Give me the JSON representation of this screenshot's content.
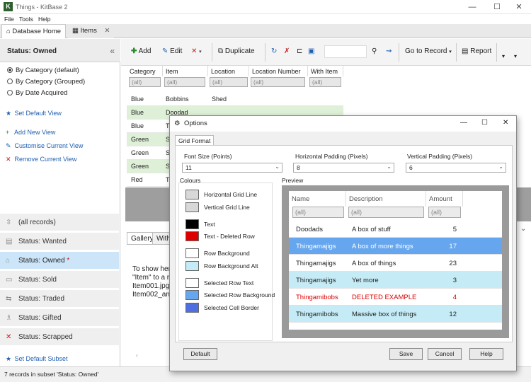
{
  "window": {
    "title": "Things - KitBase 2",
    "app_letter": "K"
  },
  "window_controls": {
    "minimize": "—",
    "maximize": "☐",
    "close": "✕"
  },
  "menu": [
    "File",
    "Tools",
    "Help"
  ],
  "doc_tabs": [
    {
      "label": "Database Home",
      "icon": "home-icon"
    },
    {
      "label": "Items",
      "icon": "table-icon",
      "close": "✕"
    }
  ],
  "left": {
    "header": "Status: Owned",
    "collapse": "«",
    "radios": [
      "By Category (default)",
      "By Category (Grouped)",
      "By Date Acquired"
    ],
    "links": [
      {
        "icon": "★",
        "label": "Set Default View",
        "color": "#1f5fb0"
      },
      {
        "icon": "+",
        "label": "Add New View",
        "color": "#2a8a2a"
      },
      {
        "icon": "✎",
        "label": "Customise Current View",
        "color": "#1f5fb0"
      },
      {
        "icon": "✕",
        "label": "Remove Current View",
        "color": "#c02020"
      }
    ],
    "subsets": [
      {
        "label": "(all records)",
        "icon": "⇳"
      },
      {
        "label": "Status: Wanted",
        "icon": "▤"
      },
      {
        "label": "Status: Owned",
        "icon": "⌂",
        "marker": "*"
      },
      {
        "label": "Status: Sold",
        "icon": "▭"
      },
      {
        "label": "Status: Traded",
        "icon": "⇆"
      },
      {
        "label": "Status: Gifted",
        "icon": "♗"
      },
      {
        "label": "Status: Scrapped",
        "icon": "✕"
      }
    ],
    "set_default_subset": "Set Default Subset"
  },
  "toolbar": {
    "add": "Add",
    "edit": "Edit",
    "duplicate": "Duplicate",
    "goto": "Go to Record",
    "report": "Report"
  },
  "grid": {
    "columns": [
      "Category",
      "Item",
      "Location",
      "Location Number",
      "With Item"
    ],
    "filter": "(all)",
    "rows": [
      [
        "Blue",
        "Bobbins",
        "Shed"
      ],
      [
        "Blue",
        "Doodad",
        ""
      ],
      [
        "Blue",
        "T",
        ""
      ],
      [
        "Green",
        "S",
        ""
      ],
      [
        "Green",
        "S",
        ""
      ],
      [
        "Green",
        "S",
        ""
      ],
      [
        "Red",
        "T",
        ""
      ]
    ]
  },
  "bottom": {
    "tabs": [
      "Gallery",
      "With"
    ],
    "text": [
      "To show her",
      "\"Item\" to a r",
      "",
      "Item001.jpg",
      "Item002_and"
    ]
  },
  "dialog": {
    "title": "Options",
    "tab": "Grid Format",
    "font_size": {
      "label": "Font Size (Points)",
      "value": "11"
    },
    "h_padding": {
      "label": "Horizontal Padding (Pixels)",
      "value": "8"
    },
    "v_padding": {
      "label": "Vertical Padding (Pixels)",
      "value": "6"
    },
    "colours_label": "Colours",
    "preview_label": "Preview",
    "colours": [
      {
        "label": "Horizontal Grid Line",
        "color": "#d8d8d8"
      },
      {
        "label": "Vertical Grid Line",
        "color": "#d8d8d8"
      },
      {
        "label": "Text",
        "color": "#000000"
      },
      {
        "label": "Text - Deleted Row",
        "color": "#dd0000"
      },
      {
        "label": "Row Background",
        "color": "#ffffff"
      },
      {
        "label": "Row Background Alt",
        "color": "#c5ecf6"
      },
      {
        "label": "Selected Row Text",
        "color": "#ffffff"
      },
      {
        "label": "Selected Row Background",
        "color": "#66a6ee"
      },
      {
        "label": "Selected Cell Border",
        "color": "#4f6ee0"
      }
    ],
    "preview": {
      "columns": [
        "Name",
        "Description",
        "Amount"
      ],
      "filter": "(all)",
      "rows": [
        {
          "name": "Doodads",
          "desc": "A box of stuff",
          "amt": "5",
          "style": "normal"
        },
        {
          "name": "Thingamajigs",
          "desc": "A box of more things",
          "amt": "17",
          "style": "selected"
        },
        {
          "name": "Thingamajigs",
          "desc": "A box of things",
          "amt": "23",
          "style": "normal"
        },
        {
          "name": "Thingamajigs",
          "desc": "Yet more",
          "amt": "3",
          "style": "alt"
        },
        {
          "name": "Thingamibobs",
          "desc": "DELETED EXAMPLE",
          "amt": "4",
          "style": "deleted"
        },
        {
          "name": "Thingamibobs",
          "desc": "Massive box of things",
          "amt": "12",
          "style": "alt"
        }
      ]
    },
    "buttons": {
      "default": "Default",
      "save": "Save",
      "cancel": "Cancel",
      "help": "Help"
    }
  },
  "status": "7 records in subset 'Status: Owned'"
}
